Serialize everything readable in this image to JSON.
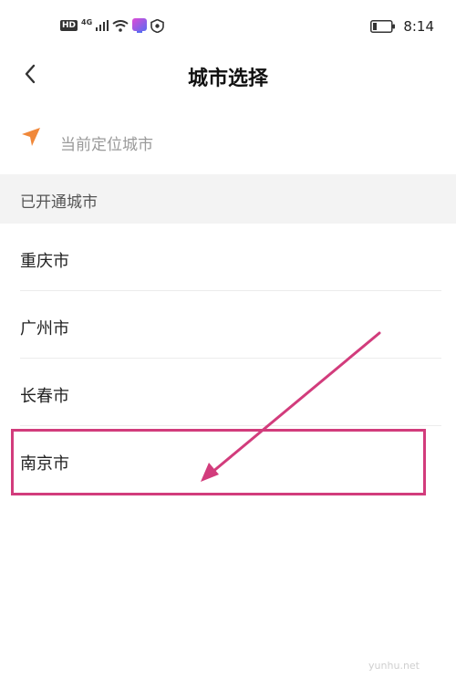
{
  "status_bar": {
    "hd_badge": "HD",
    "network_type": "4G",
    "time": "8:14"
  },
  "header": {
    "title": "城市选择"
  },
  "location": {
    "label": "当前定位城市"
  },
  "section": {
    "title": "已开通城市"
  },
  "cities": [
    {
      "label": "重庆市"
    },
    {
      "label": "广州市"
    },
    {
      "label": "长春市"
    },
    {
      "label": "南京市"
    }
  ],
  "annotation": {
    "color": "#d23c7c"
  },
  "watermark": "yunhu.net",
  "colors": {
    "location_icon": "#f0883a",
    "section_bg": "#f3f3f3"
  }
}
